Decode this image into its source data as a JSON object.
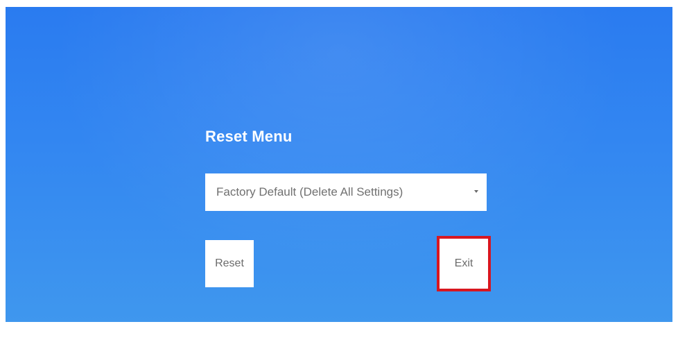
{
  "reset_menu": {
    "title": "Reset Menu",
    "select": {
      "selected": "Factory Default (Delete All Settings)"
    },
    "reset_label": "Reset",
    "exit_label": "Exit"
  },
  "colors": {
    "background": "#3387f1",
    "highlight_border": "#d8161f"
  }
}
